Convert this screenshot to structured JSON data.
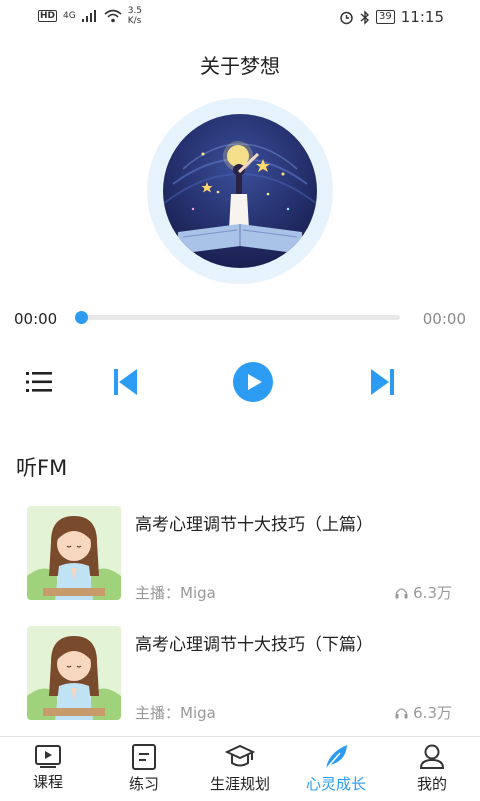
{
  "status_bar": {
    "network_left": "HD",
    "net_type": "4G",
    "speed": "3.5",
    "speed_unit": "K/s",
    "battery": "39",
    "time": "11:15"
  },
  "player": {
    "title": "关于梦想",
    "current_time": "00:00",
    "total_time": "00:00",
    "progress": 0
  },
  "fm": {
    "section_title": "听FM",
    "items": [
      {
        "title": "高考心理调节十大技巧（上篇）",
        "host": "主播：Miga",
        "plays": "6.3万"
      },
      {
        "title": "高考心理调节十大技巧（下篇）",
        "host": "主播：Miga",
        "plays": "6.3万"
      }
    ]
  },
  "tabs": [
    {
      "label": "课程",
      "icon": "play-video-icon"
    },
    {
      "label": "练习",
      "icon": "practice-icon"
    },
    {
      "label": "生涯规划",
      "icon": "graduation-cap-icon"
    },
    {
      "label": "心灵成长",
      "icon": "feather-icon"
    },
    {
      "label": "我的",
      "icon": "profile-icon"
    }
  ],
  "accent_color": "#2b9cf2"
}
